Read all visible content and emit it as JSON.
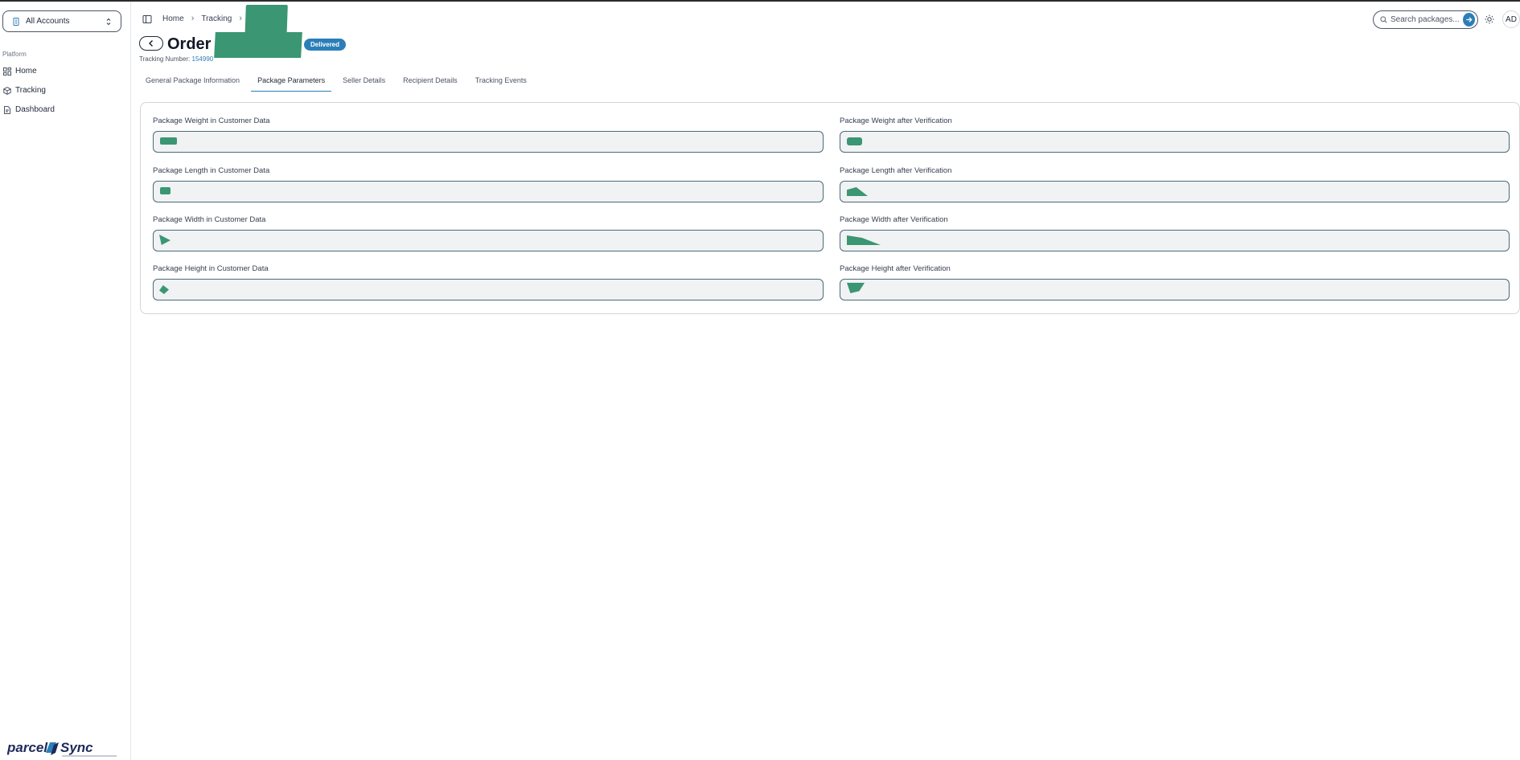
{
  "sidebar": {
    "account": "All Accounts",
    "group_label": "Platform",
    "items": [
      {
        "label": "Home"
      },
      {
        "label": "Tracking"
      },
      {
        "label": "Dashboard"
      }
    ],
    "brand": "parcelSync"
  },
  "header": {
    "breadcrumb": [
      "Home",
      "Tracking"
    ],
    "search_placeholder": "Search packages...",
    "avatar": "AD"
  },
  "order": {
    "title": "Order",
    "status": "Delivered",
    "tracking_label": "Tracking Number:",
    "tracking_number": "154990"
  },
  "tabs": [
    {
      "label": "General Package Information",
      "active": false
    },
    {
      "label": "Package Parameters",
      "active": true
    },
    {
      "label": "Seller Details",
      "active": false
    },
    {
      "label": "Recipient Details",
      "active": false
    },
    {
      "label": "Tracking Events",
      "active": false
    }
  ],
  "fields": {
    "weight_customer": "Package Weight in Customer Data",
    "weight_verified": "Package Weight after Verification",
    "length_customer": "Package Length in Customer Data",
    "length_verified": "Package Length after Verification",
    "width_customer": "Package Width in Customer Data",
    "width_verified": "Package Width after Verification",
    "height_customer": "Package Height in Customer Data",
    "height_verified": "Package Height after Verification"
  },
  "colors": {
    "accent": "#2b7fb8",
    "redaction": "#3a9673"
  }
}
